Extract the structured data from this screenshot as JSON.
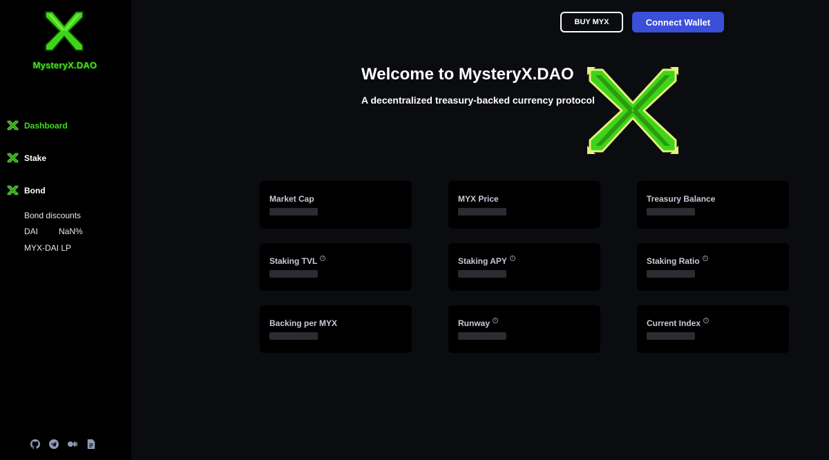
{
  "sidebar": {
    "brand_name": "MysteryX.DAO",
    "nav": [
      {
        "label": "Dashboard",
        "active": true
      },
      {
        "label": "Stake",
        "active": false
      },
      {
        "label": "Bond",
        "active": false
      }
    ],
    "bond_header": "Bond discounts",
    "bonds": [
      {
        "name": "DAI",
        "rate": "NaN%"
      },
      {
        "name": "MYX-DAI LP",
        "rate": ""
      }
    ],
    "social_icons": [
      "github-icon",
      "telegram-icon",
      "medium-icon",
      "docs-icon"
    ]
  },
  "header": {
    "buy_label": "BUY MYX",
    "connect_label": "Connect Wallet"
  },
  "hero": {
    "title": "Welcome to MysteryX.DAO",
    "subtitle": "A decentralized treasury-backed currency protocol"
  },
  "cards": [
    {
      "label": "Market Cap",
      "info": false
    },
    {
      "label": "MYX Price",
      "info": false
    },
    {
      "label": "Treasury Balance",
      "info": false
    },
    {
      "label": "Staking TVL",
      "info": true
    },
    {
      "label": "Staking APY",
      "info": true
    },
    {
      "label": "Staking Ratio",
      "info": true
    },
    {
      "label": "Backing per MYX",
      "info": false
    },
    {
      "label": "Runway",
      "info": true
    },
    {
      "label": "Current Index",
      "info": true
    }
  ],
  "colors": {
    "accent_green": "#3ce01a",
    "connect_blue": "#3b4fd8",
    "card_bg": "#000000",
    "page_bg": "#0b0c0f"
  }
}
